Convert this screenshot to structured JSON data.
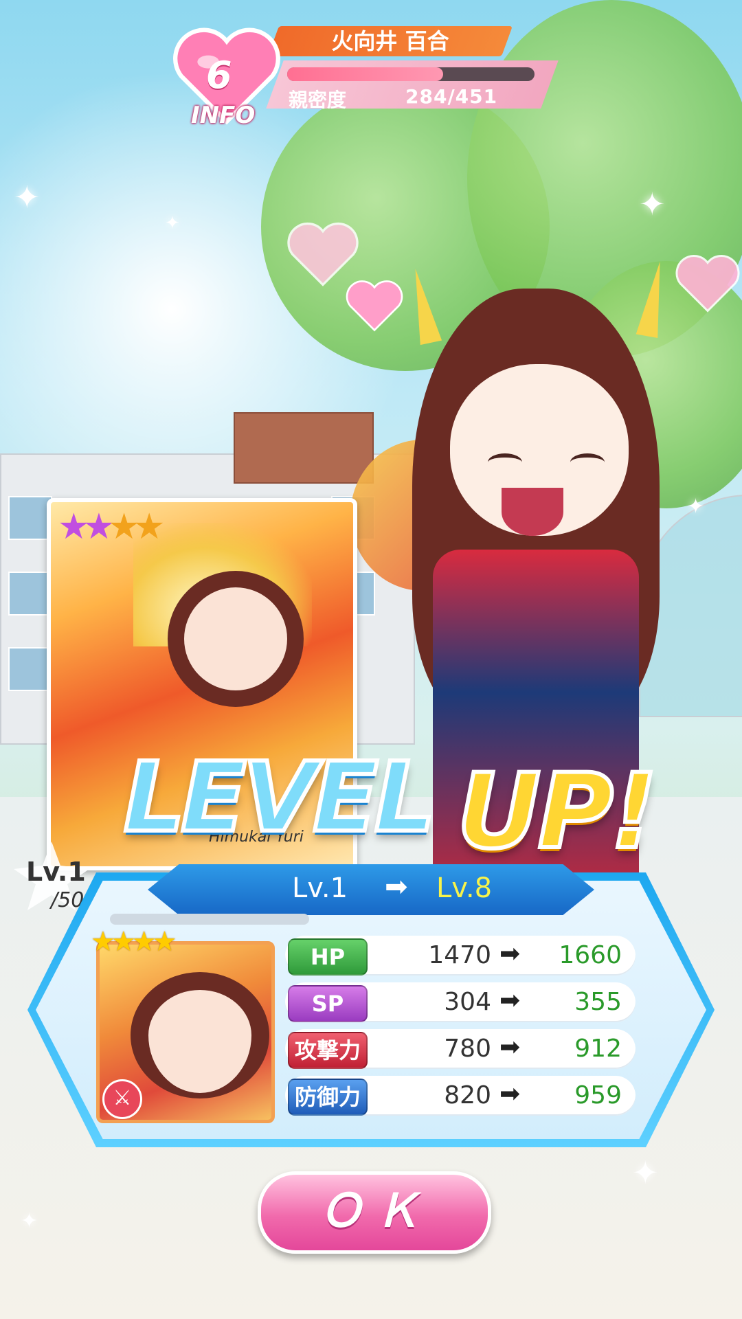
{
  "info": {
    "idol_name": "火向井 百合",
    "heart_level": "6",
    "info_label": "INFO",
    "affection_label": "親密度",
    "affection_value": "284/451",
    "affection_progress": 0.63
  },
  "card": {
    "rarity_stars": 4,
    "name_romaji": "Himukai Yuri",
    "level_current": "Lv.1",
    "level_max": "/50"
  },
  "banner": {
    "level_text": "LEVEL",
    "up_text": "UP!"
  },
  "level_change": {
    "from": "Lv.1",
    "to": "Lv.8"
  },
  "stats": [
    {
      "label": "HP",
      "old": "1470",
      "new": "1660",
      "color": "#3fae46"
    },
    {
      "label": "SP",
      "old": "304",
      "new": "355",
      "color": "#b04fd2"
    },
    {
      "label": "攻撃力",
      "old": "780",
      "new": "912",
      "color": "#d63344"
    },
    {
      "label": "防御力",
      "old": "820",
      "new": "959",
      "color": "#2f73cc"
    }
  ],
  "ok_button": {
    "label": "ＯＫ"
  },
  "icons": {
    "arrow": "➡",
    "heart": "heart-icon",
    "role": "sword-icon"
  },
  "colors": {
    "accent_pink": "#f16aac",
    "panel_blue": "#1ea8f0",
    "new_value_green": "#2a9a2a"
  }
}
